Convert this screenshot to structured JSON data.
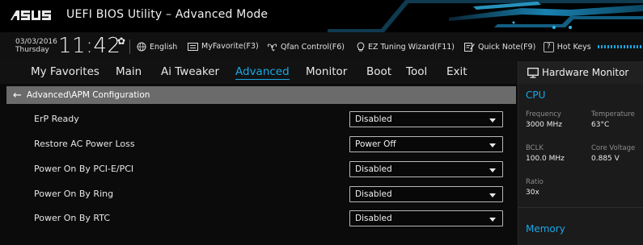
{
  "titlebar": {
    "brand": "ASUS",
    "title": "UEFI BIOS Utility – Advanced Mode"
  },
  "infobar": {
    "date": "03/03/2016",
    "day": "Thursday",
    "time": "11:42",
    "tools": [
      {
        "label": "English",
        "icon": "globe-icon"
      },
      {
        "label": "MyFavorite(F3)",
        "icon": "favorite-icon"
      },
      {
        "label": "Qfan Control(F6)",
        "icon": "fan-icon"
      },
      {
        "label": "EZ Tuning Wizard(F11)",
        "icon": "bulb-icon"
      },
      {
        "label": "Quick Note(F9)",
        "icon": "note-icon"
      },
      {
        "label": "Hot Keys",
        "icon": "help-icon"
      }
    ]
  },
  "menu": {
    "items": [
      "My Favorites",
      "Main",
      "Ai Tweaker",
      "Advanced",
      "Monitor",
      "Boot",
      "Tool",
      "Exit"
    ],
    "active": "Advanced"
  },
  "breadcrumb": "Advanced\\APM Configuration",
  "settings": [
    {
      "label": "ErP Ready",
      "value": "Disabled"
    },
    {
      "label": "Restore AC Power Loss",
      "value": "Power Off"
    },
    {
      "label": "Power On By PCI-E/PCI",
      "value": "Disabled"
    },
    {
      "label": "Power On By Ring",
      "value": "Disabled"
    },
    {
      "label": "Power On By RTC",
      "value": "Disabled"
    }
  ],
  "hw_monitor": {
    "title": "Hardware Monitor",
    "cpu": {
      "heading": "CPU",
      "frequency_label": "Frequency",
      "frequency": "3000 MHz",
      "temperature_label": "Temperature",
      "temperature": "63°C",
      "bclk_label": "BCLK",
      "bclk": "100.0 MHz",
      "core_voltage_label": "Core Voltage",
      "core_voltage": "0.885 V",
      "ratio_label": "Ratio",
      "ratio": "30x"
    },
    "memory_heading": "Memory"
  },
  "colors": {
    "accent": "#18a8e6",
    "breadcrumb_bg": "#6b6b6b",
    "panel_bg": "#1b1b1b"
  }
}
